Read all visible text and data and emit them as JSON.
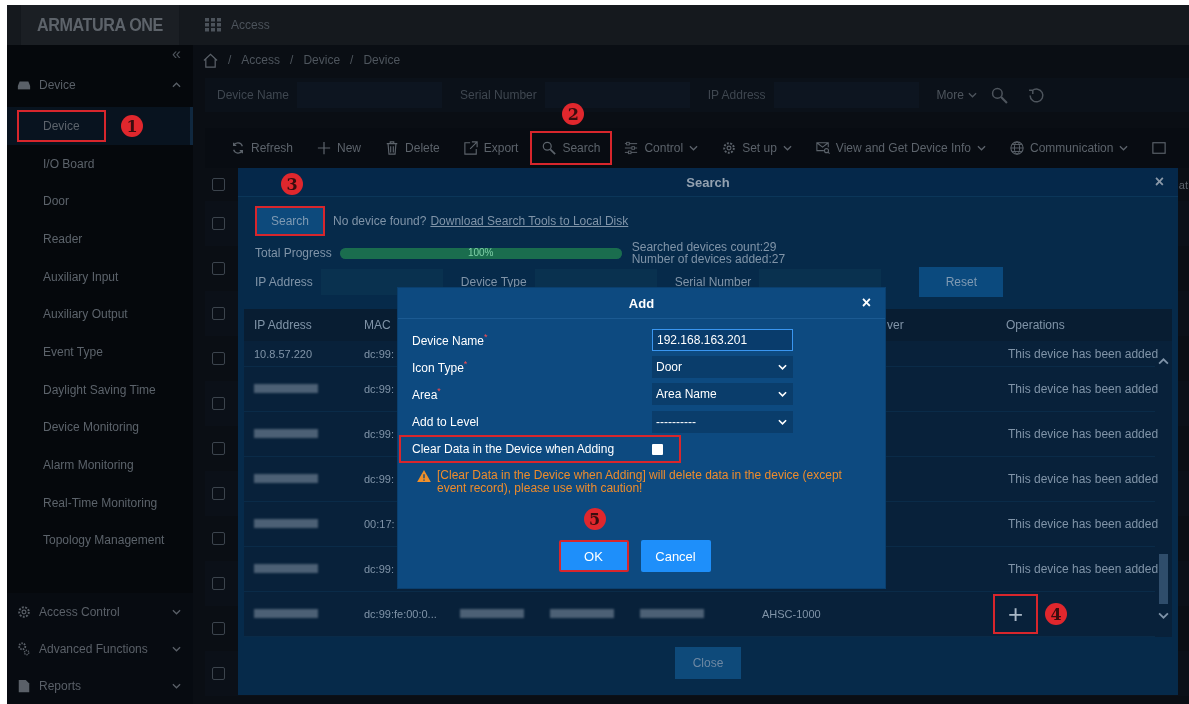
{
  "app": {
    "logo": "ARMATURA ONE",
    "module": "Access"
  },
  "sidebar": {
    "collapse": "«",
    "groups": [
      {
        "label": "Device",
        "expanded": true,
        "items": [
          {
            "label": "Device",
            "selected": true,
            "highlighted": true,
            "step": "1"
          },
          {
            "label": "I/O Board",
            "selected": false,
            "highlighted": false
          },
          {
            "label": "Door",
            "selected": false,
            "highlighted": false
          },
          {
            "label": "Reader",
            "selected": false,
            "highlighted": false
          },
          {
            "label": "Auxiliary Input",
            "selected": false,
            "highlighted": false
          },
          {
            "label": "Auxiliary Output",
            "selected": false,
            "highlighted": false
          },
          {
            "label": "Event Type",
            "selected": false,
            "highlighted": false
          },
          {
            "label": "Daylight Saving Time",
            "selected": false,
            "highlighted": false
          },
          {
            "label": "Device Monitoring",
            "selected": false,
            "highlighted": false
          },
          {
            "label": "Alarm Monitoring",
            "selected": false,
            "highlighted": false
          },
          {
            "label": "Real-Time Monitoring",
            "selected": false,
            "highlighted": false
          },
          {
            "label": "Topology Management",
            "selected": false,
            "highlighted": false
          }
        ]
      },
      {
        "label": "Access Control",
        "expanded": false
      },
      {
        "label": "Advanced Functions",
        "expanded": false
      },
      {
        "label": "Reports",
        "expanded": false
      }
    ]
  },
  "breadcrumb": [
    {
      "sep": "/",
      "label": "Access"
    },
    {
      "sep": "/",
      "label": "Device"
    },
    {
      "sep": "/",
      "label": "Device"
    }
  ],
  "filters": [
    {
      "label": "Device Name"
    },
    {
      "label": "Serial Number"
    },
    {
      "label": "IP Address"
    }
  ],
  "more": "More",
  "toolbar": [
    {
      "label": "Refresh",
      "dropdown": false,
      "highlighted": false
    },
    {
      "label": "New",
      "dropdown": false,
      "highlighted": false
    },
    {
      "label": "Delete",
      "dropdown": false,
      "highlighted": false
    },
    {
      "label": "Export",
      "dropdown": false,
      "highlighted": false
    },
    {
      "label": "Search",
      "dropdown": false,
      "highlighted": true,
      "step": "2"
    },
    {
      "label": "Control",
      "dropdown": true,
      "highlighted": false
    },
    {
      "label": "Set up",
      "dropdown": true,
      "highlighted": false
    },
    {
      "label": "View and Get Device Info",
      "dropdown": true,
      "highlighted": false
    },
    {
      "label": "Communication",
      "dropdown": true,
      "highlighted": false
    }
  ],
  "device_table": {
    "header_checked": false,
    "column_cut": "at",
    "rows": [
      {
        "checked": false
      },
      {
        "checked": false
      },
      {
        "checked": false
      },
      {
        "checked": false
      },
      {
        "checked": false
      },
      {
        "checked": false
      },
      {
        "checked": false
      },
      {
        "checked": false
      },
      {
        "checked": false
      },
      {
        "checked": false
      },
      {
        "checked": false
      }
    ]
  },
  "search_dialog": {
    "title": "Search",
    "close": "×",
    "search_button": {
      "label": "Search",
      "highlighted": true,
      "step": "3"
    },
    "hint": "No device found?",
    "link": "Download Search Tools to Local Disk",
    "progress": {
      "label": "Total Progress",
      "level": 1,
      "reading": "100%"
    },
    "stats": [
      "Searched devices count:29",
      "Number of devices added:27"
    ],
    "filters": [
      {
        "label": "IP Address"
      },
      {
        "label": "Device Type"
      },
      {
        "label": "Serial Number"
      }
    ],
    "reset": "Reset",
    "columns": [
      "IP Address",
      "MAC",
      "ver",
      "Operations"
    ],
    "rows": [
      {
        "cells": [
          {
            "kind": "text",
            "text": "10.8.57.220"
          },
          {
            "kind": "text",
            "text": "dc:99:"
          }
        ],
        "operation": {
          "kind": "status",
          "text": "This device has been added"
        }
      },
      {
        "cells": [
          {
            "kind": "redacted"
          },
          {
            "kind": "text",
            "text": "dc:99:"
          }
        ],
        "operation": {
          "kind": "status",
          "text": "This device has been added"
        }
      },
      {
        "cells": [
          {
            "kind": "redacted"
          },
          {
            "kind": "text",
            "text": "dc:99:"
          }
        ],
        "operation": {
          "kind": "status",
          "text": "This device has been added"
        }
      },
      {
        "cells": [
          {
            "kind": "redacted"
          },
          {
            "kind": "text",
            "text": "dc:99:"
          }
        ],
        "operation": {
          "kind": "status",
          "text": "This device has been added"
        }
      },
      {
        "cells": [
          {
            "kind": "redacted"
          },
          {
            "kind": "text",
            "text": "00:17:"
          }
        ],
        "operation": {
          "kind": "status",
          "text": "This device has been added"
        }
      },
      {
        "cells": [
          {
            "kind": "redacted"
          },
          {
            "kind": "text",
            "text": "dc:99:"
          }
        ],
        "operation": {
          "kind": "status",
          "text": "This device has been added"
        }
      },
      {
        "cells": [
          {
            "kind": "redacted"
          },
          {
            "kind": "text",
            "text": "dc:99:fe:00:0..."
          },
          {
            "kind": "redacted"
          },
          {
            "kind": "redacted"
          },
          {
            "kind": "redacted"
          },
          {
            "kind": "text",
            "text": "AHSC-1000"
          }
        ],
        "operation": {
          "kind": "add",
          "glyph": "+",
          "highlighted": true,
          "step": "4"
        }
      }
    ],
    "close_button": "Close"
  },
  "add_dialog": {
    "title": "Add",
    "close": "×",
    "fields": [
      {
        "kind": "input",
        "label": "Device Name",
        "mark": "*",
        "value": "192.168.163.201"
      },
      {
        "kind": "select",
        "label": "Icon Type",
        "mark": "*",
        "value": "Door"
      },
      {
        "kind": "select",
        "label": "Area",
        "mark": "*",
        "value": "Area Name"
      },
      {
        "kind": "select",
        "label": "Add to Level",
        "value": "----------"
      },
      {
        "kind": "checkbox",
        "label": "Clear Data in the Device when Adding",
        "checked": false,
        "highlighted": true
      }
    ],
    "warning": "[Clear Data in the Device when Adding] will delete data in the device (except event record), please use with caution!",
    "buttons": [
      {
        "label": "OK",
        "highlighted": true,
        "step": "5"
      },
      {
        "label": "Cancel",
        "highlighted": false
      }
    ]
  }
}
